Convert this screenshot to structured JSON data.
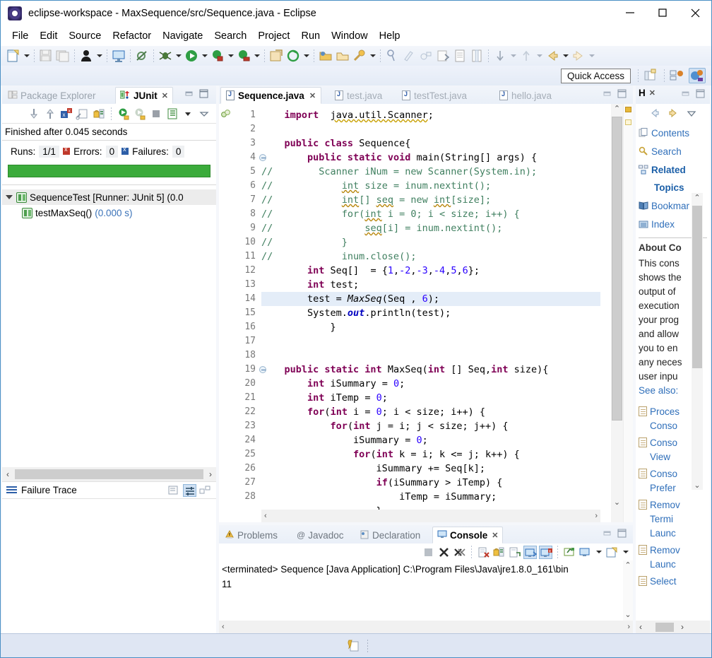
{
  "window": {
    "title": "eclipse-workspace - MaxSequence/src/Sequence.java - Eclipse",
    "icon": "eclipse-icon",
    "minimize": "–",
    "maximize": "□",
    "close": "✕"
  },
  "menubar": {
    "items": [
      "File",
      "Edit",
      "Source",
      "Refactor",
      "Navigate",
      "Search",
      "Project",
      "Run",
      "Window",
      "Help"
    ]
  },
  "toolbar2": {
    "quick_access": "Quick Access"
  },
  "junit_view": {
    "tabs": [
      {
        "label": "Package Explorer",
        "icon": "package-explorer-icon",
        "active": false
      },
      {
        "label": "JUnit",
        "icon": "junit-icon",
        "active": true,
        "close": "✕"
      }
    ],
    "status": "Finished after 0.045 seconds",
    "counters": {
      "runs_label": "Runs:",
      "runs_value": "1/1",
      "errors_label": "Errors:",
      "errors_value": "0",
      "failures_label": "Failures:",
      "failures_value": "0"
    },
    "progress_color": "#3bab3b",
    "tree": [
      {
        "label": "SequenceTest [Runner: JUnit 5] (0.0",
        "time": "",
        "depth": 0,
        "selected": true
      },
      {
        "label": "testMaxSeq()",
        "time": "(0.000 s)",
        "depth": 1,
        "selected": false
      }
    ],
    "failure_trace": "Failure Trace"
  },
  "editor": {
    "tabs": [
      {
        "label": "Sequence.java",
        "active": true,
        "close": "✕"
      },
      {
        "label": "test.java",
        "active": false
      },
      {
        "label": "testTest.java",
        "active": false
      },
      {
        "label": "hello.java",
        "active": false
      }
    ],
    "highlighted_line": 14,
    "lines": [
      {
        "n": "1",
        "fold": false,
        "html": "    <span class=\"kw\">import</span>  <span class=\"imp\">java.util.Scanner</span>;"
      },
      {
        "n": "2",
        "fold": false,
        "html": ""
      },
      {
        "n": "3",
        "fold": false,
        "html": "    <span class=\"kw\">public class</span> Sequence{"
      },
      {
        "n": "4",
        "fold": true,
        "html": "        <span class=\"kw\">public static void</span> main(String[] args) {"
      },
      {
        "n": "5",
        "fold": false,
        "html": "<span class=\"cm\">//        Scanner iNum = new Scanner(System.in);</span>"
      },
      {
        "n": "6",
        "fold": false,
        "html": "<span class=\"cm\">//            <span class=\"spell\">int</span> size = inum.nextint();</span>"
      },
      {
        "n": "7",
        "fold": false,
        "html": "<span class=\"cm\">//            <span class=\"spell\">int</span>[] <span class=\"spell\">seq</span> = new <span class=\"spell\">int</span>[size];</span>"
      },
      {
        "n": "8",
        "fold": false,
        "html": "<span class=\"cm\">//            for(<span class=\"spell\">int</span> i = 0; i &lt; size; i++) {</span>"
      },
      {
        "n": "9",
        "fold": false,
        "html": "<span class=\"cm\">//                <span class=\"spell\">seq</span>[i] = inum.nextint();</span>"
      },
      {
        "n": "10",
        "fold": false,
        "html": "<span class=\"cm\">//            }</span>"
      },
      {
        "n": "11",
        "fold": false,
        "html": "<span class=\"cm\">//            inum.close();</span>"
      },
      {
        "n": "12",
        "fold": false,
        "html": "        <span class=\"kw\">int</span> Seq[]  = {<span class=\"st\">1</span>,<span class=\"st\">-2</span>,<span class=\"st\">-3</span>,<span class=\"st\">-4</span>,<span class=\"st\">5</span>,<span class=\"st\">6</span>};"
      },
      {
        "n": "13",
        "fold": false,
        "html": "        <span class=\"kw\">int</span> test;"
      },
      {
        "n": "14",
        "fold": false,
        "html": "        test = <span class=\"ital\">MaxSeq</span>(Seq , <span class=\"st\">6</span>);"
      },
      {
        "n": "15",
        "fold": false,
        "html": "        System.<span class=\"fieldb\">out</span>.println(test);"
      },
      {
        "n": "16",
        "fold": false,
        "html": "            }"
      },
      {
        "n": "17",
        "fold": false,
        "html": ""
      },
      {
        "n": "18",
        "fold": false,
        "html": ""
      },
      {
        "n": "19",
        "fold": true,
        "html": "    <span class=\"kw\">public static int</span> MaxSeq(<span class=\"kw\">int</span> [] Seq,<span class=\"kw\">int</span> size){"
      },
      {
        "n": "20",
        "fold": false,
        "html": "        <span class=\"kw\">int</span> iSummary = <span class=\"st\">0</span>;"
      },
      {
        "n": "21",
        "fold": false,
        "html": "        <span class=\"kw\">int</span> iTemp = <span class=\"st\">0</span>;"
      },
      {
        "n": "22",
        "fold": false,
        "html": "        <span class=\"kw\">for</span>(<span class=\"kw\">int</span> i = <span class=\"st\">0</span>; i &lt; size; i++) {"
      },
      {
        "n": "23",
        "fold": false,
        "html": "            <span class=\"kw\">for</span>(<span class=\"kw\">int</span> j = i; j &lt; size; j++) {"
      },
      {
        "n": "24",
        "fold": false,
        "html": "                iSummary = <span class=\"st\">0</span>;"
      },
      {
        "n": "25",
        "fold": false,
        "html": "                <span class=\"kw\">for</span>(<span class=\"kw\">int</span> k = i; k &lt;= j; k++) {"
      },
      {
        "n": "26",
        "fold": false,
        "html": "                    iSummary += Seq[k];"
      },
      {
        "n": "27",
        "fold": false,
        "html": "                    <span class=\"kw\">if</span>(iSummary &gt; iTemp) {"
      },
      {
        "n": "28",
        "fold": false,
        "html": "                        iTemp = iSummary;"
      },
      {
        "n": "",
        "fold": false,
        "html": "                    }"
      }
    ]
  },
  "console_view": {
    "tabs": [
      {
        "label": "Problems",
        "icon": "problems-icon",
        "active": false
      },
      {
        "label": "Javadoc",
        "icon": "javadoc-icon",
        "active": false
      },
      {
        "label": "Declaration",
        "icon": "declaration-icon",
        "active": false
      },
      {
        "label": "Console",
        "icon": "console-icon",
        "active": true,
        "close": "✕"
      }
    ],
    "process_line": "<terminated> Sequence [Java Application] C:\\Program Files\\Java\\jre1.8.0_161\\bin",
    "output": "11"
  },
  "help_view": {
    "tab_label": "H",
    "tab_close": "✕",
    "links": [
      {
        "label": "Contents",
        "icon": "contents-icon",
        "bold": false
      },
      {
        "label": "Search",
        "icon": "search-icon",
        "bold": false
      },
      {
        "label": "Related",
        "icon": "related-topics-icon",
        "bold": true
      },
      {
        "label": "Bookmar",
        "icon": "bookmarks-icon",
        "bold": false
      },
      {
        "label": "Index",
        "icon": "index-icon",
        "bold": false
      }
    ],
    "related_sub": "Topics",
    "about_title": "About Co",
    "about_body": [
      "This cons",
      "shows the",
      "output of",
      "execution",
      "your prog",
      "and allow",
      "you to en",
      "any neces",
      "user inpu"
    ],
    "see_also_label": "See also:",
    "references": [
      [
        "Proces",
        "Conso"
      ],
      [
        "Conso",
        "View"
      ],
      [
        "Conso",
        "Prefer"
      ],
      [
        "Remov",
        "Termi",
        "Launc"
      ],
      [
        "Remov",
        "Launc"
      ],
      [
        "Select"
      ]
    ]
  },
  "statusbar": {
    "icon": "java-perspective-indicator"
  },
  "colors": {
    "accent": "#4a8fc4",
    "junit_pass": "#3bab3b",
    "keyword": "#7f0055",
    "comment": "#3f7f5f",
    "string": "#2a00ff",
    "link": "#2f6fba",
    "highlight_line": "#e4edf8"
  }
}
